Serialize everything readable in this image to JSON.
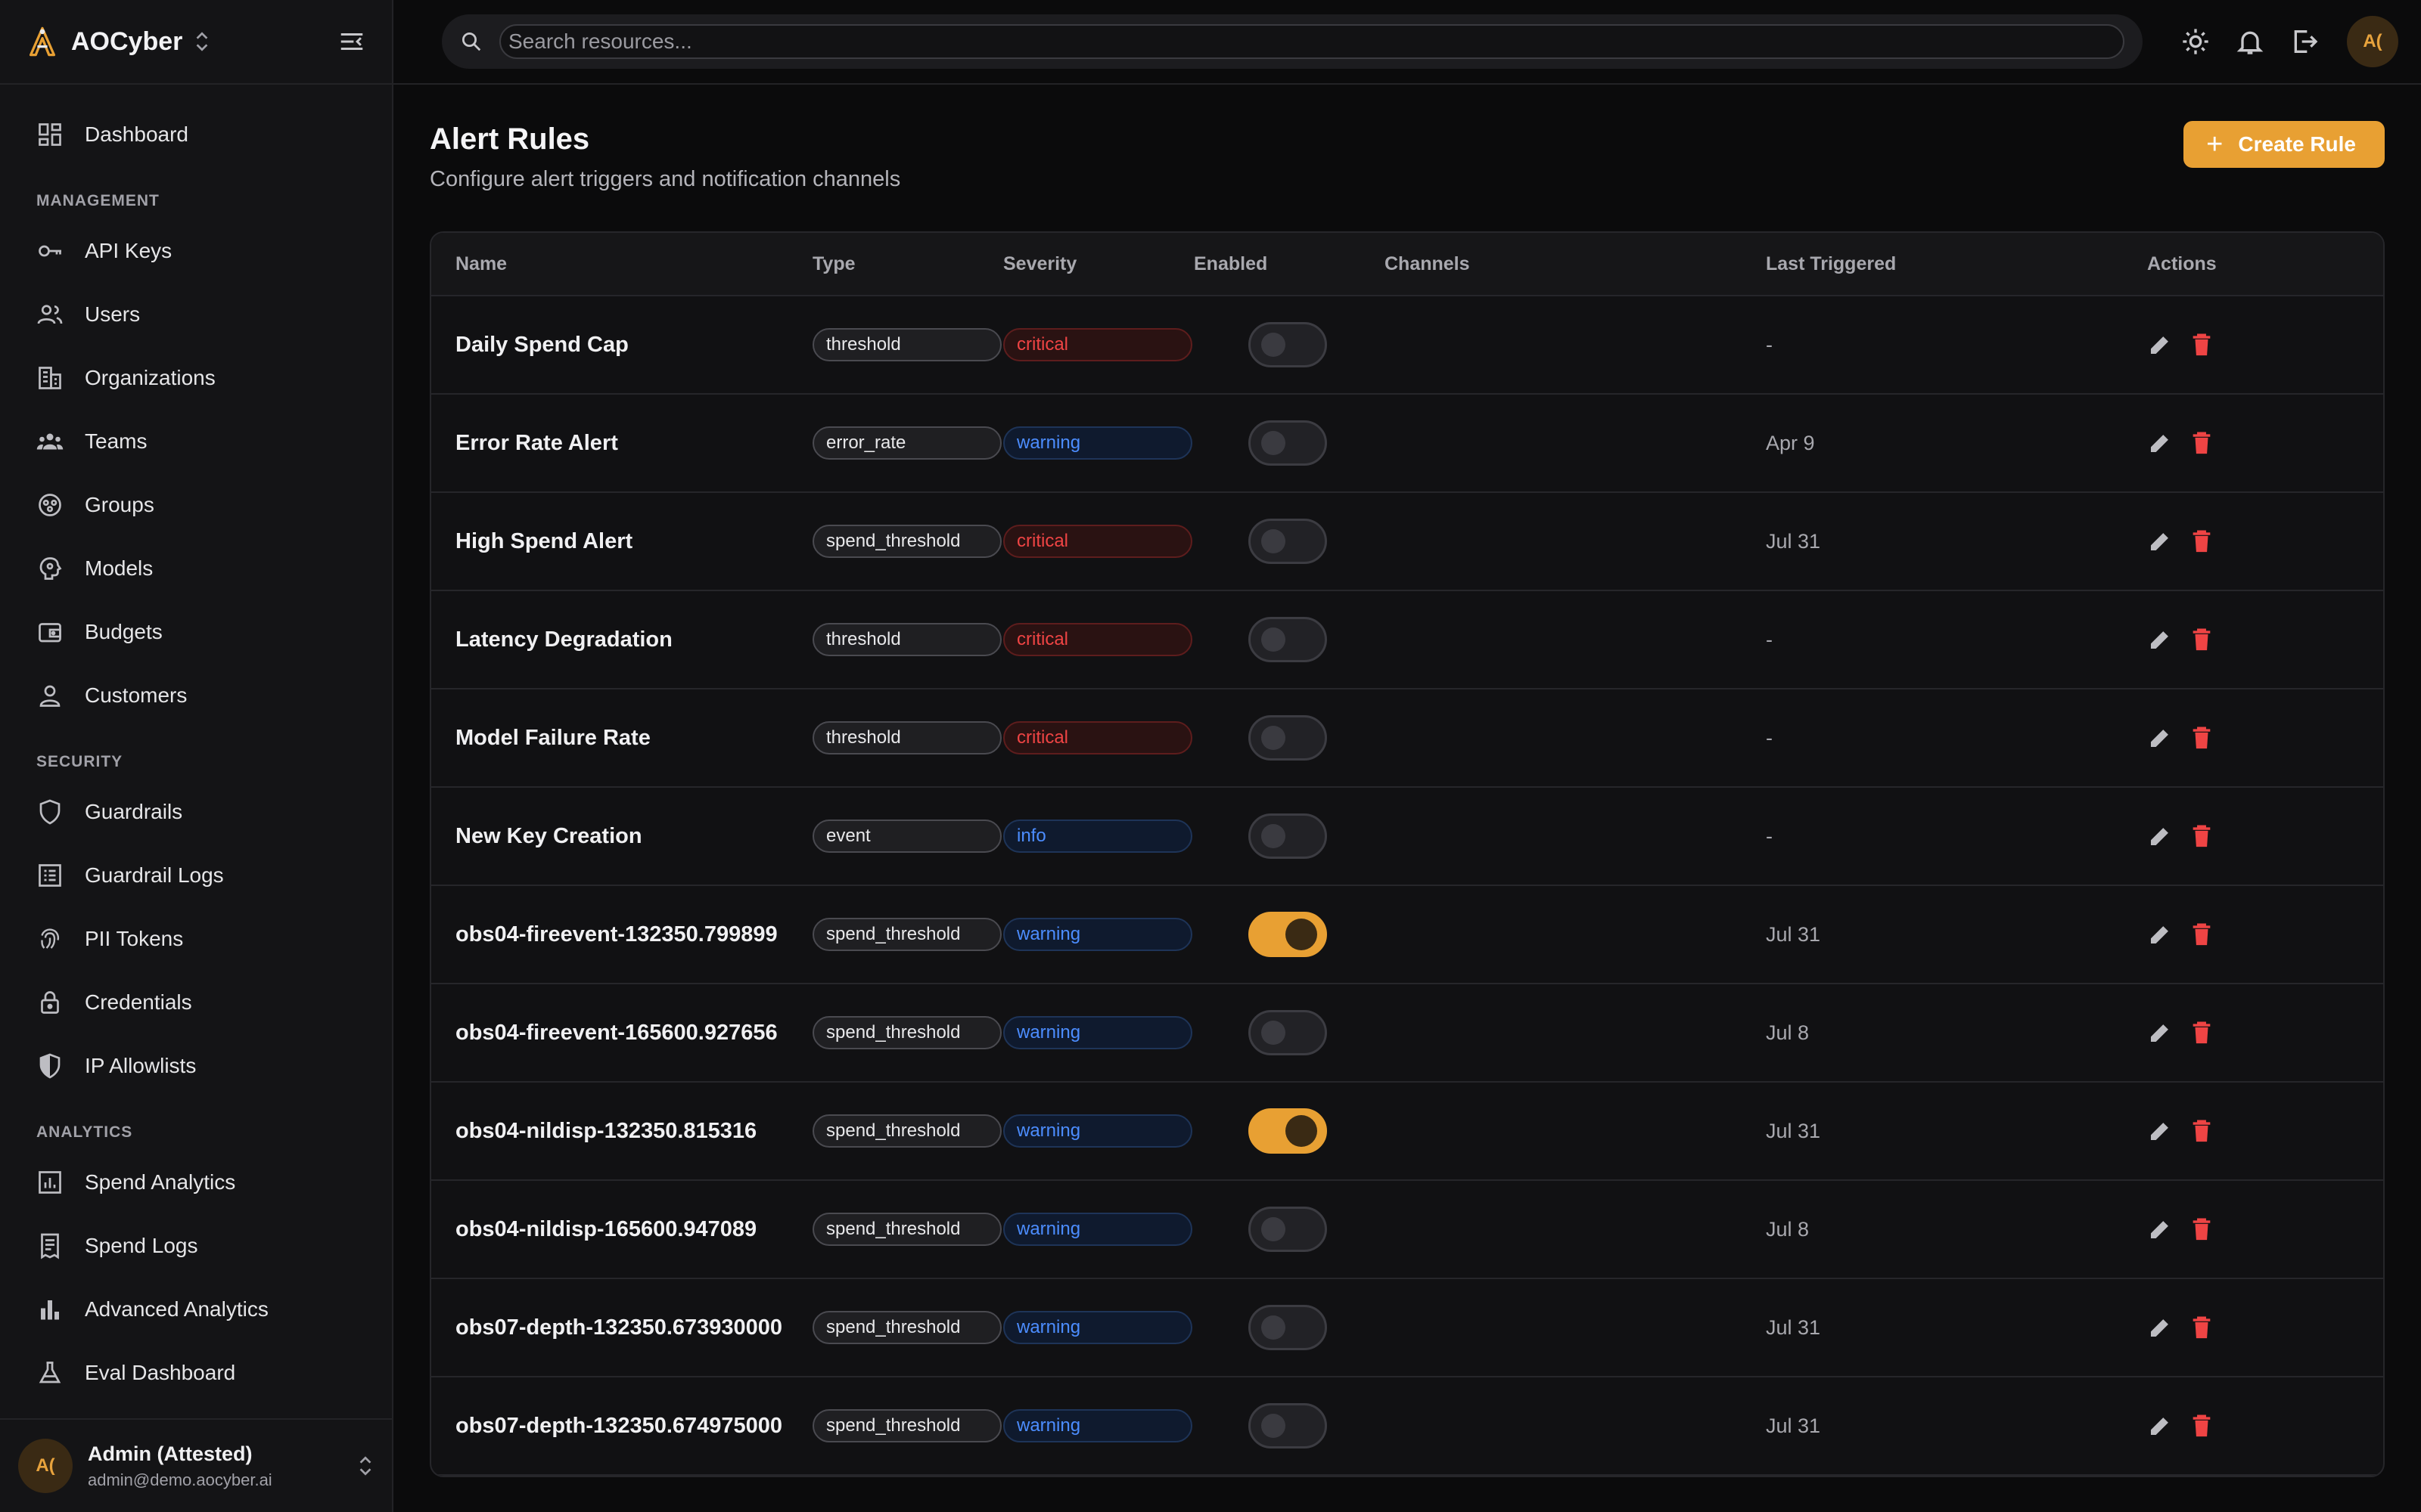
{
  "brand": {
    "name": "AOCyber"
  },
  "colors": {
    "accent": "#e8a033",
    "critical": "#ef4444",
    "warning": "#4c8dff",
    "bg": "#0b0b0c"
  },
  "sidebar": {
    "top": [
      {
        "label": "Dashboard",
        "icon": "dashboard-icon"
      }
    ],
    "sections": [
      {
        "title": "MANAGEMENT",
        "items": [
          {
            "label": "API Keys",
            "icon": "key-icon"
          },
          {
            "label": "Users",
            "icon": "users-icon"
          },
          {
            "label": "Organizations",
            "icon": "building-icon"
          },
          {
            "label": "Teams",
            "icon": "team-icon"
          },
          {
            "label": "Groups",
            "icon": "groups-icon"
          },
          {
            "label": "Models",
            "icon": "model-icon"
          },
          {
            "label": "Budgets",
            "icon": "wallet-icon"
          },
          {
            "label": "Customers",
            "icon": "customer-icon"
          }
        ]
      },
      {
        "title": "SECURITY",
        "items": [
          {
            "label": "Guardrails",
            "icon": "shield-icon"
          },
          {
            "label": "Guardrail Logs",
            "icon": "log-icon"
          },
          {
            "label": "PII Tokens",
            "icon": "fingerprint-icon"
          },
          {
            "label": "Credentials",
            "icon": "lock-icon"
          },
          {
            "label": "IP Allowlists",
            "icon": "shield-half-icon"
          }
        ]
      },
      {
        "title": "ANALYTICS",
        "items": [
          {
            "label": "Spend Analytics",
            "icon": "analytics-icon"
          },
          {
            "label": "Spend Logs",
            "icon": "receipt-icon"
          },
          {
            "label": "Advanced Analytics",
            "icon": "bar-chart-icon"
          },
          {
            "label": "Eval Dashboard",
            "icon": "flask-icon"
          }
        ]
      }
    ]
  },
  "user": {
    "initials": "A(",
    "name": "Admin (Attested)",
    "email": "admin@demo.aocyber.ai"
  },
  "search": {
    "placeholder": "Search resources..."
  },
  "page": {
    "title": "Alert Rules",
    "subtitle": "Configure alert triggers and notification channels",
    "create_label": "Create Rule"
  },
  "table": {
    "columns": [
      "Name",
      "Type",
      "Severity",
      "Enabled",
      "Channels",
      "Last Triggered",
      "Actions"
    ],
    "rows": [
      {
        "name": "Daily Spend Cap",
        "type": "threshold",
        "severity": "critical",
        "enabled": false,
        "channels": "",
        "last": "-"
      },
      {
        "name": "Error Rate Alert",
        "type": "error_rate",
        "severity": "warning",
        "enabled": false,
        "channels": "",
        "last": "Apr 9"
      },
      {
        "name": "High Spend Alert",
        "type": "spend_threshold",
        "severity": "critical",
        "enabled": false,
        "channels": "",
        "last": "Jul 31"
      },
      {
        "name": "Latency Degradation",
        "type": "threshold",
        "severity": "critical",
        "enabled": false,
        "channels": "",
        "last": "-"
      },
      {
        "name": "Model Failure Rate",
        "type": "threshold",
        "severity": "critical",
        "enabled": false,
        "channels": "",
        "last": "-"
      },
      {
        "name": "New Key Creation",
        "type": "event",
        "severity": "info",
        "enabled": false,
        "channels": "",
        "last": "-"
      },
      {
        "name": "obs04-fireevent-132350.799899",
        "type": "spend_threshold",
        "severity": "warning",
        "enabled": true,
        "channels": "",
        "last": "Jul 31"
      },
      {
        "name": "obs04-fireevent-165600.927656",
        "type": "spend_threshold",
        "severity": "warning",
        "enabled": false,
        "channels": "",
        "last": "Jul 8"
      },
      {
        "name": "obs04-nildisp-132350.815316",
        "type": "spend_threshold",
        "severity": "warning",
        "enabled": true,
        "channels": "",
        "last": "Jul 31"
      },
      {
        "name": "obs04-nildisp-165600.947089",
        "type": "spend_threshold",
        "severity": "warning",
        "enabled": false,
        "channels": "",
        "last": "Jul 8"
      },
      {
        "name": "obs07-depth-132350.673930000",
        "type": "spend_threshold",
        "severity": "warning",
        "enabled": false,
        "channels": "",
        "last": "Jul 31"
      },
      {
        "name": "obs07-depth-132350.674975000",
        "type": "spend_threshold",
        "severity": "warning",
        "enabled": false,
        "channels": "",
        "last": "Jul 31"
      }
    ]
  }
}
